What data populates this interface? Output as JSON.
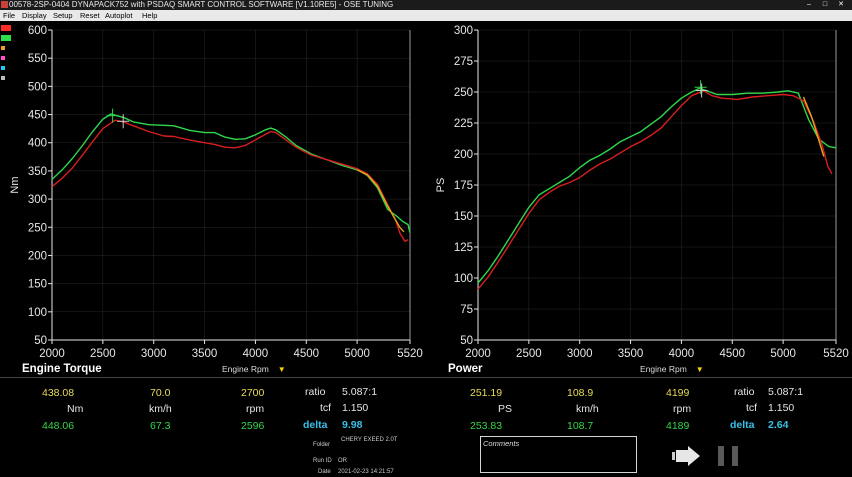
{
  "window": {
    "title": "00578-2SP-0404 DYNAPACK752 with PSDAQ SMART CONTROL SOFTWARE [V1.10RE5] - OSE TUNING",
    "min": "–",
    "max": "□",
    "close": "✕"
  },
  "menu": [
    "File",
    "Display",
    "Setup",
    "Reset",
    "Autoplot",
    "Help"
  ],
  "swatches": [
    "#ff2a2a",
    "#2be04a",
    "#f0a020",
    "#ff4fd0",
    "#23c8ff",
    "#bbbbbb"
  ],
  "chart_data": [
    {
      "type": "line",
      "title": "Engine Torque",
      "xlabel": "",
      "ylabel": "Nm",
      "xlim": [
        2000,
        5520
      ],
      "ylim": [
        50,
        600
      ],
      "xticks": [
        "2000",
        "2500",
        "3000",
        "3500",
        "4000",
        "4500",
        "5000",
        "5520"
      ],
      "yticks": [
        "50",
        "100",
        "150",
        "200",
        "250",
        "300",
        "350",
        "400",
        "450",
        "500",
        "550",
        "600"
      ],
      "series": [
        {
          "color": "#2fd84a",
          "x": [
            2000,
            2100,
            2200,
            2300,
            2400,
            2500,
            2580,
            2700,
            2800,
            2950,
            3100,
            3200,
            3350,
            3500,
            3600,
            3700,
            3800,
            3900,
            4000,
            4100,
            4150,
            4200,
            4300,
            4400,
            4550,
            4700,
            4850,
            5000,
            5100,
            5200,
            5300,
            5400,
            5450,
            5500,
            5520
          ],
          "y": [
            335,
            352,
            372,
            395,
            420,
            442,
            451,
            445,
            437,
            432,
            431,
            430,
            422,
            418,
            418,
            410,
            406,
            407,
            414,
            423,
            426,
            423,
            410,
            395,
            380,
            370,
            360,
            352,
            342,
            320,
            282,
            268,
            260,
            255,
            240
          ]
        },
        {
          "color": "#d81e1e",
          "x": [
            2000,
            2100,
            2200,
            2300,
            2400,
            2500,
            2620,
            2700,
            2800,
            2950,
            3100,
            3200,
            3350,
            3500,
            3600,
            3700,
            3800,
            3900,
            4000,
            4100,
            4150,
            4200,
            4300,
            4400,
            4550,
            4700,
            4850,
            5000,
            5100,
            5200,
            5300,
            5380,
            5420,
            5470,
            5500
          ],
          "y": [
            322,
            337,
            355,
            378,
            402,
            425,
            440,
            437,
            430,
            420,
            412,
            411,
            405,
            400,
            397,
            392,
            391,
            395,
            405,
            415,
            420,
            418,
            405,
            392,
            378,
            370,
            362,
            354,
            345,
            326,
            290,
            262,
            240,
            225,
            228
          ]
        },
        {
          "color": "#e8a020",
          "x": [
            5000,
            5100,
            5200,
            5300,
            5380,
            5420,
            5460
          ],
          "y": [
            352,
            343,
            323,
            288,
            262,
            250,
            242
          ]
        }
      ],
      "markers": [
        {
          "x": 2596,
          "y": 448,
          "color": "#2fd84a"
        },
        {
          "x": 2700,
          "y": 438,
          "color": "#cccccc"
        }
      ]
    },
    {
      "type": "line",
      "title": "Power",
      "xlabel": "",
      "ylabel": "PS",
      "xlim": [
        2000,
        5520
      ],
      "ylim": [
        50,
        300
      ],
      "xticks": [
        "2000",
        "2500",
        "3000",
        "3500",
        "4000",
        "4500",
        "5000",
        "5520"
      ],
      "yticks": [
        "50",
        "75",
        "100",
        "125",
        "150",
        "175",
        "200",
        "225",
        "250",
        "275",
        "300"
      ],
      "series": [
        {
          "color": "#2fd84a",
          "x": [
            2000,
            2100,
            2200,
            2300,
            2400,
            2500,
            2600,
            2700,
            2800,
            2900,
            3000,
            3100,
            3200,
            3300,
            3400,
            3500,
            3600,
            3700,
            3800,
            3900,
            4000,
            4100,
            4180,
            4250,
            4350,
            4500,
            4650,
            4800,
            4950,
            5050,
            5150,
            5250,
            5350,
            5450,
            5520
          ],
          "y": [
            96,
            106,
            118,
            131,
            144,
            157,
            167,
            172,
            177,
            182,
            189,
            195,
            199,
            204,
            210,
            214,
            218,
            224,
            230,
            238,
            245,
            250,
            253,
            251,
            248,
            248,
            249,
            249,
            250,
            251,
            249,
            228,
            212,
            206,
            205
          ]
        },
        {
          "color": "#d81e1e",
          "x": [
            2000,
            2100,
            2200,
            2300,
            2400,
            2500,
            2600,
            2700,
            2800,
            2900,
            3000,
            3100,
            3200,
            3300,
            3400,
            3500,
            3600,
            3700,
            3800,
            3900,
            4000,
            4100,
            4220,
            4300,
            4400,
            4550,
            4700,
            4850,
            5000,
            5100,
            5200,
            5300,
            5380,
            5440,
            5480
          ],
          "y": [
            91,
            101,
            113,
            126,
            139,
            152,
            163,
            169,
            174,
            177,
            181,
            187,
            192,
            196,
            201,
            206,
            210,
            215,
            221,
            230,
            239,
            247,
            251,
            247,
            245,
            244,
            246,
            247,
            248,
            247,
            243,
            226,
            208,
            190,
            184
          ]
        },
        {
          "color": "#e8a020",
          "x": [
            5200,
            5280,
            5340,
            5400
          ],
          "y": [
            246,
            230,
            214,
            198
          ]
        }
      ],
      "markers": [
        {
          "x": 4189,
          "y": 253.83,
          "color": "#2fd84a"
        },
        {
          "x": 4199,
          "y": 251.19,
          "color": "#cccccc"
        }
      ]
    }
  ],
  "readouts": {
    "engine_rpm_label": "Engine Rpm",
    "torque": {
      "run1": {
        "value": "438.08",
        "speed": "70.0",
        "rpm": "2700"
      },
      "units": {
        "value": "Nm",
        "speed": "km/h",
        "rpm": "rpm"
      },
      "run2": {
        "value": "448.06",
        "speed": "67.3",
        "rpm": "2596"
      },
      "ratio_label": "ratio",
      "ratio": "5.087:1",
      "tcf_label": "tcf",
      "tcf": "1.150",
      "delta_label": "delta",
      "delta": "9.98"
    },
    "power": {
      "run1": {
        "value": "251.19",
        "speed": "108.9",
        "rpm": "4199"
      },
      "units": {
        "value": "PS",
        "speed": "km/h",
        "rpm": "rpm"
      },
      "run2": {
        "value": "253.83",
        "speed": "108.7",
        "rpm": "4189"
      },
      "ratio_label": "ratio",
      "ratio": "5.087:1",
      "tcf_label": "tcf",
      "tcf": "1.150",
      "delta_label": "delta",
      "delta": "2.64"
    }
  },
  "info": {
    "folder_label": "Folder",
    "folder": "CHERY EXEED 2.0T",
    "run_label": "Run ID",
    "run": "OR",
    "date_label": "Date",
    "date": "2021-02-23 14:21:57"
  },
  "comments": {
    "label": "Comments"
  }
}
